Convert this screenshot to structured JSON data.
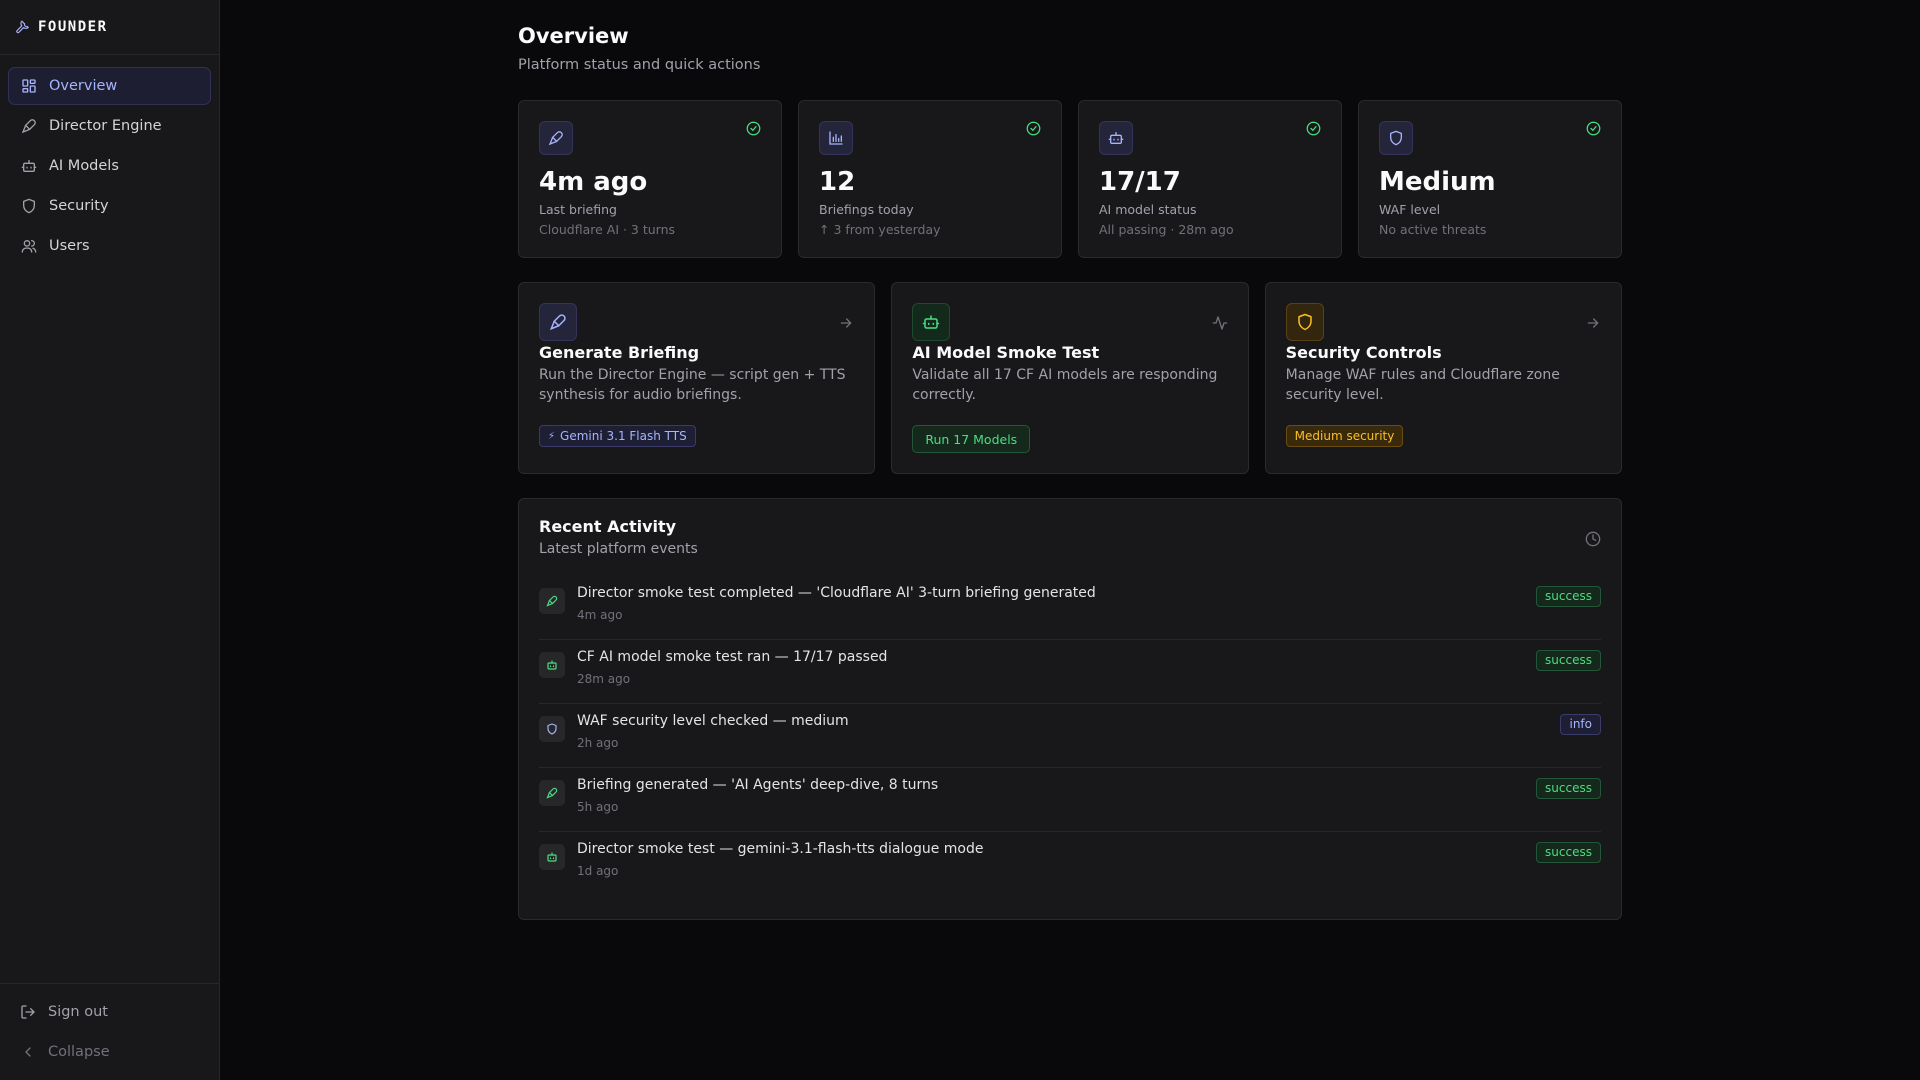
{
  "brand": {
    "name": "FOUNDER",
    "icon": "wrench-icon"
  },
  "sidebar": {
    "items": [
      {
        "label": "Overview",
        "icon": "dashboard-icon",
        "active": true
      },
      {
        "label": "Director Engine",
        "icon": "mic-icon",
        "active": false
      },
      {
        "label": "AI Models",
        "icon": "bot-icon",
        "active": false
      },
      {
        "label": "Security",
        "icon": "shield-icon",
        "active": false
      },
      {
        "label": "Users",
        "icon": "users-icon",
        "active": false
      }
    ],
    "footer": [
      {
        "label": "Sign out",
        "icon": "logout-icon"
      },
      {
        "label": "Collapse",
        "icon": "chevron-left-icon"
      }
    ]
  },
  "header": {
    "title": "Overview",
    "subtitle": "Platform status and quick actions"
  },
  "stats": [
    {
      "icon": "mic-icon",
      "value": "4m ago",
      "label": "Last briefing",
      "detail": "Cloudflare AI · 3 turns",
      "status": "ok"
    },
    {
      "icon": "bar-chart-icon",
      "value": "12",
      "label": "Briefings today",
      "detail": "↑ 3 from yesterday",
      "status": "ok"
    },
    {
      "icon": "bot-icon",
      "value": "17/17",
      "label": "AI model status",
      "detail": "All passing · 28m ago",
      "status": "ok"
    },
    {
      "icon": "shield-icon",
      "value": "Medium",
      "label": "WAF level",
      "detail": "No active threats",
      "status": "ok"
    }
  ],
  "actions": [
    {
      "icon": "mic-icon",
      "title": "Generate Briefing",
      "description": "Run the Director Engine — script gen + TTS synthesis for audio briefings.",
      "tag": "Gemini 3.1 Flash TTS",
      "tag_icon": "sparkle-icon",
      "corner_icon": "arrow-right-icon"
    },
    {
      "icon": "bot-icon",
      "title": "AI Model Smoke Test",
      "description": "Validate all 17 CF AI models are responding correctly.",
      "button": "Run 17 Models",
      "corner_icon": "activity-icon"
    },
    {
      "icon": "shield-icon",
      "title": "Security Controls",
      "description": "Manage WAF rules and Cloudflare zone security level.",
      "tag": "Medium security",
      "corner_icon": "arrow-right-icon"
    }
  ],
  "activity": {
    "title": "Recent Activity",
    "subtitle": "Latest platform events",
    "header_icon": "clock-icon",
    "events": [
      {
        "icon": "mic-icon",
        "text": "Director smoke test completed — 'Cloudflare AI' 3-turn briefing generated",
        "time": "4m ago",
        "status": "success"
      },
      {
        "icon": "bot-icon",
        "text": "CF AI model smoke test ran — 17/17 passed",
        "time": "28m ago",
        "status": "success"
      },
      {
        "icon": "shield-icon",
        "text": "WAF security level checked — medium",
        "time": "2h ago",
        "status": "info"
      },
      {
        "icon": "mic-icon",
        "text": "Briefing generated — 'AI Agents' deep-dive, 8 turns",
        "time": "5h ago",
        "status": "success"
      },
      {
        "icon": "bot-icon",
        "text": "Director smoke test — gemini-3.1-flash-tts dialogue mode",
        "time": "1d ago",
        "status": "success"
      }
    ]
  },
  "colors": {
    "background": "#09090b",
    "surface": "#18181b",
    "accent": "#a5b4fc",
    "success": "#4ade80",
    "warning": "#fbbf24"
  }
}
